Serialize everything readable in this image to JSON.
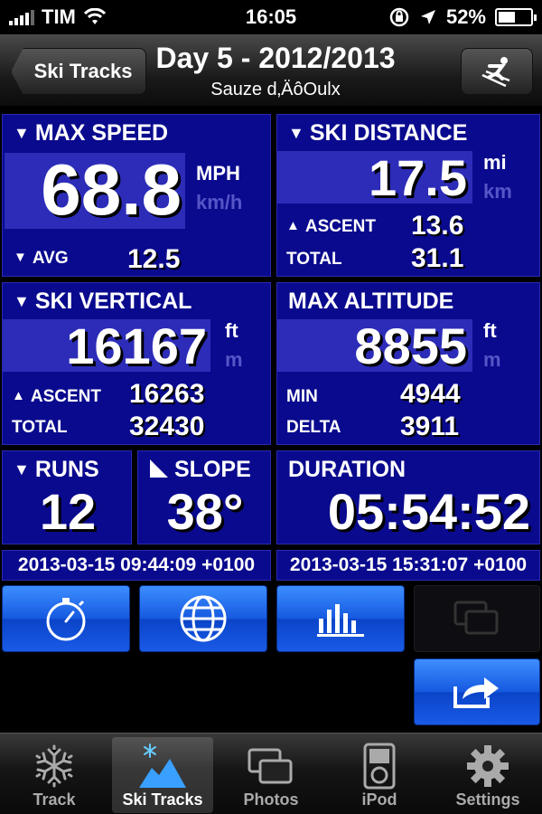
{
  "status": {
    "carrier": "TIM",
    "time": "16:05",
    "battery": "52%"
  },
  "nav": {
    "back_label": "Ski Tracks",
    "title": "Day 5 - 2012/2013",
    "subtitle": "Sauze d‚ÄôOulx"
  },
  "max_speed": {
    "title": "MAX SPEED",
    "value": "68.8",
    "unit_active": "MPH",
    "unit_inactive": "km/h",
    "avg_label": "AVG",
    "avg_value": "12.5"
  },
  "ski_distance": {
    "title": "SKI DISTANCE",
    "value": "17.5",
    "unit_active": "mi",
    "unit_inactive": "km",
    "ascent_label": "ASCENT",
    "ascent_value": "13.6",
    "total_label": "TOTAL",
    "total_value": "31.1"
  },
  "ski_vertical": {
    "title": "SKI VERTICAL",
    "value": "16167",
    "unit_active": "ft",
    "unit_inactive": "m",
    "ascent_label": "ASCENT",
    "ascent_value": "16263",
    "total_label": "TOTAL",
    "total_value": "32430"
  },
  "max_altitude": {
    "title": "MAX ALTITUDE",
    "value": "8855",
    "unit_active": "ft",
    "unit_inactive": "m",
    "min_label": "MIN",
    "min_value": "4944",
    "delta_label": "DELTA",
    "delta_value": "3911"
  },
  "runs": {
    "title": "RUNS",
    "value": "12"
  },
  "slope": {
    "title": "SLOPE",
    "value": "38°"
  },
  "duration": {
    "title": "DURATION",
    "value": "05:54:52"
  },
  "dates": {
    "start": "2013-03-15 09:44:09 +0100",
    "end": "2013-03-15 15:31:07 +0100"
  },
  "actions": [
    {
      "icon": "stopwatch-icon"
    },
    {
      "icon": "globe-icon"
    },
    {
      "icon": "bar-chart-icon"
    },
    {
      "icon": "photos-icon"
    },
    {
      "icon": "share-icon"
    }
  ],
  "tabs": [
    {
      "label": "Track",
      "icon": "snowflake-icon"
    },
    {
      "label": "Ski Tracks",
      "icon": "ski-tracks-icon"
    },
    {
      "label": "Photos",
      "icon": "photos-icon"
    },
    {
      "label": "iPod",
      "icon": "ipod-icon"
    },
    {
      "label": "Settings",
      "icon": "gear-icon"
    }
  ]
}
